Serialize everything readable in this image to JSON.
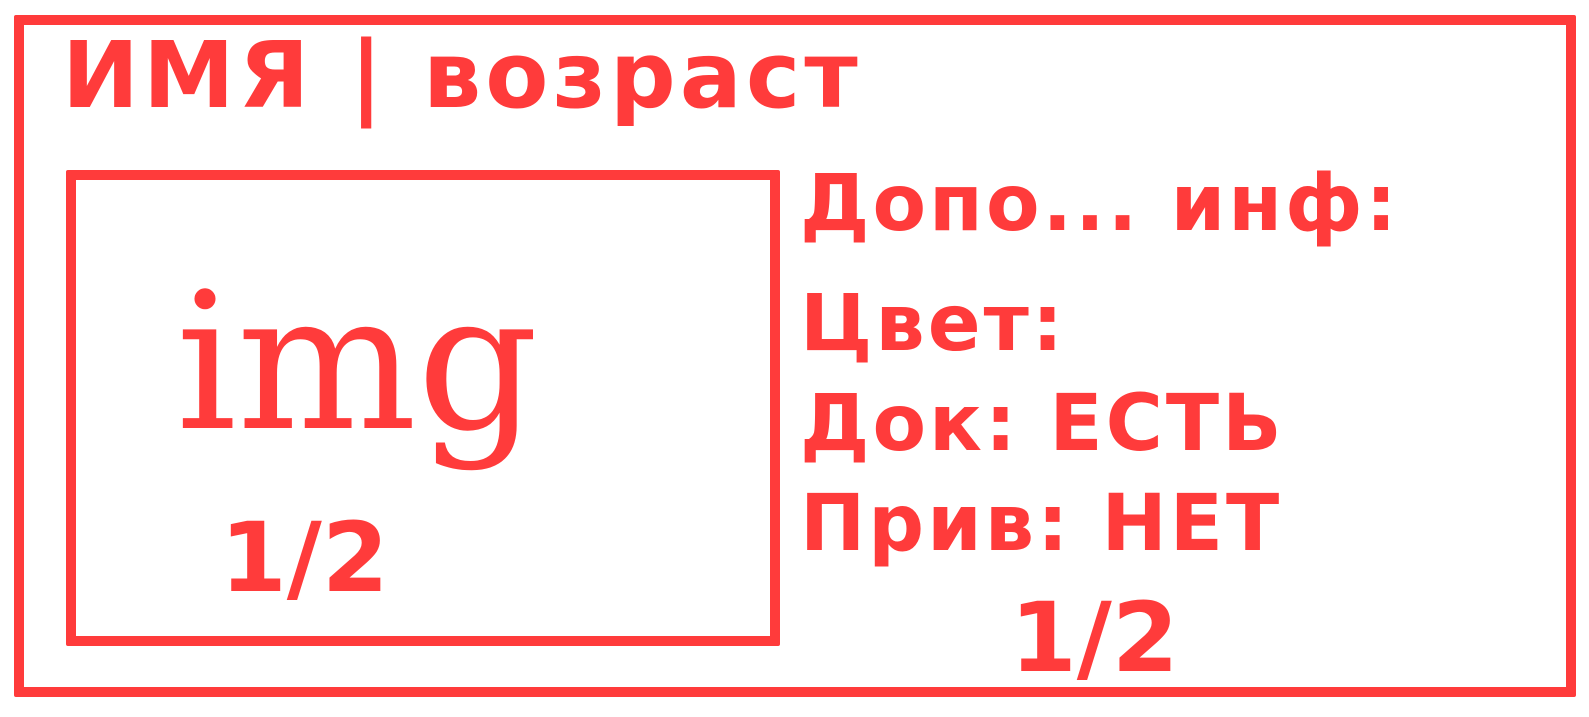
{
  "card": {
    "title": "ИМЯ | возраст",
    "image": {
      "label": "img",
      "fraction": "1/2"
    },
    "info": {
      "extra": "Допо... инф:",
      "color": "Цвет:",
      "docs": "Док: ЕСТЬ",
      "chip": "Прив: НЕТ",
      "fraction": "1/2"
    }
  },
  "colors": {
    "stroke": "#ff3b3b",
    "background": "#ffffff"
  }
}
